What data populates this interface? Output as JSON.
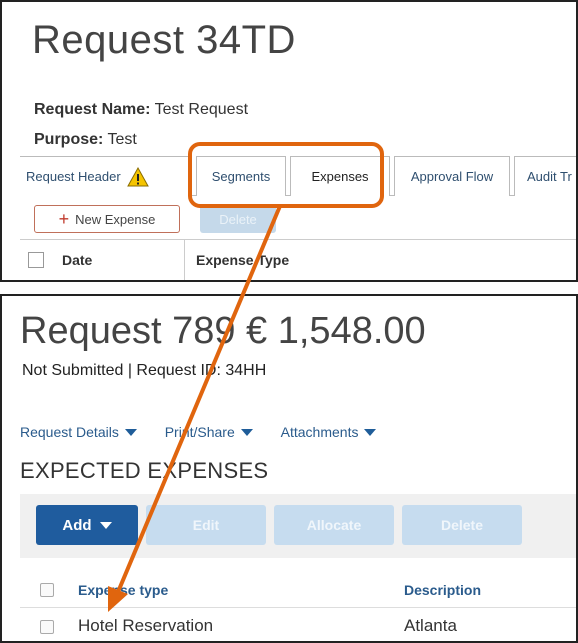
{
  "top": {
    "title": "Request 34TD",
    "request_name_label": "Request Name:",
    "request_name_value": "Test Request",
    "purpose_label": "Purpose:",
    "purpose_value": "Test",
    "tabs": [
      {
        "label": "Request Header"
      },
      {
        "label": "Segments"
      },
      {
        "label": "Expenses"
      },
      {
        "label": "Approval Flow"
      },
      {
        "label": "Audit Tr"
      }
    ],
    "new_expense_label": "New Expense",
    "delete_label": "Delete",
    "columns": [
      "Date",
      "Expense Type"
    ]
  },
  "bottom": {
    "title": "Request 789 € 1,548.00",
    "status": "Not Submitted  |  Request ID: 34HH",
    "nav": [
      {
        "label": "Request Details"
      },
      {
        "label": "Print/Share"
      },
      {
        "label": "Attachments"
      }
    ],
    "section_title": "EXPECTED EXPENSES",
    "buttons": {
      "add": "Add",
      "edit": "Edit",
      "allocate": "Allocate",
      "delete": "Delete"
    },
    "columns": [
      "Expense type",
      "Description"
    ],
    "rows": [
      {
        "expense_type": "Hotel Reservation",
        "description": "Atlanta"
      }
    ]
  },
  "colors": {
    "highlight": "#e0650e",
    "primary_button": "#1f5c9e",
    "disabled_button": "#c6dcef",
    "link": "#2a5b8c",
    "warning": "#f5c400"
  }
}
